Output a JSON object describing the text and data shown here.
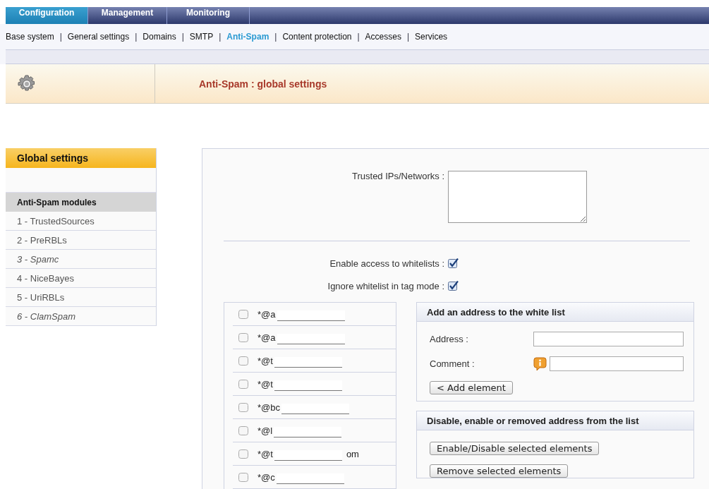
{
  "top_tabs": [
    {
      "label": "Configuration",
      "selected": true
    },
    {
      "label": "Management",
      "selected": false
    },
    {
      "label": "Monitoring",
      "selected": false
    }
  ],
  "sub_nav": [
    {
      "label": "Base system",
      "selected": false
    },
    {
      "label": "General settings",
      "selected": false
    },
    {
      "label": "Domains",
      "selected": false
    },
    {
      "label": "SMTP",
      "selected": false
    },
    {
      "label": "Anti-Spam",
      "selected": true
    },
    {
      "label": "Content protection",
      "selected": false
    },
    {
      "label": "Accesses",
      "selected": false
    },
    {
      "label": "Services",
      "selected": false
    }
  ],
  "sub_nav_separator": "|",
  "page_title": "Anti-Spam : global settings",
  "sidebar": {
    "top_item": {
      "label": "Global settings",
      "selected": true
    },
    "section_title": "Anti-Spam modules",
    "items": [
      {
        "label": "1 - TrustedSources",
        "disabled": false
      },
      {
        "label": "2 - PreRBLs",
        "disabled": false
      },
      {
        "label": "3 - Spamc",
        "disabled": true
      },
      {
        "label": "4 - NiceBayes",
        "disabled": false
      },
      {
        "label": "5 - UriRBLs",
        "disabled": false
      },
      {
        "label": "6 - ClamSpam",
        "disabled": true
      }
    ]
  },
  "settings": {
    "trusted_label": "Trusted IPs/Networks :",
    "checkboxes": [
      {
        "label": "Enable access to whitelists :",
        "checked": true
      },
      {
        "label": "Ignore whitelist in tag mode :",
        "checked": true
      }
    ]
  },
  "whitelist": [
    {
      "address": "*@a",
      "checked": false
    },
    {
      "address": "*@a",
      "checked": false
    },
    {
      "address": "*@t",
      "checked": false
    },
    {
      "address": "*@t",
      "checked": false
    },
    {
      "address": "*@bc",
      "checked": false
    },
    {
      "address": "*@l",
      "checked": false
    },
    {
      "address": "*@t",
      "suffix": "om",
      "checked": false
    },
    {
      "address": "*@c",
      "checked": false
    }
  ],
  "add_box": {
    "title": "Add an address to the white list",
    "address_label": "Address :",
    "comment_label": "Comment :",
    "button": "< Add element"
  },
  "manage_box": {
    "title": "Disable, enable or removed address from the list",
    "buttons": [
      "Enable/Disable selected elements",
      "Remove selected elements"
    ]
  }
}
